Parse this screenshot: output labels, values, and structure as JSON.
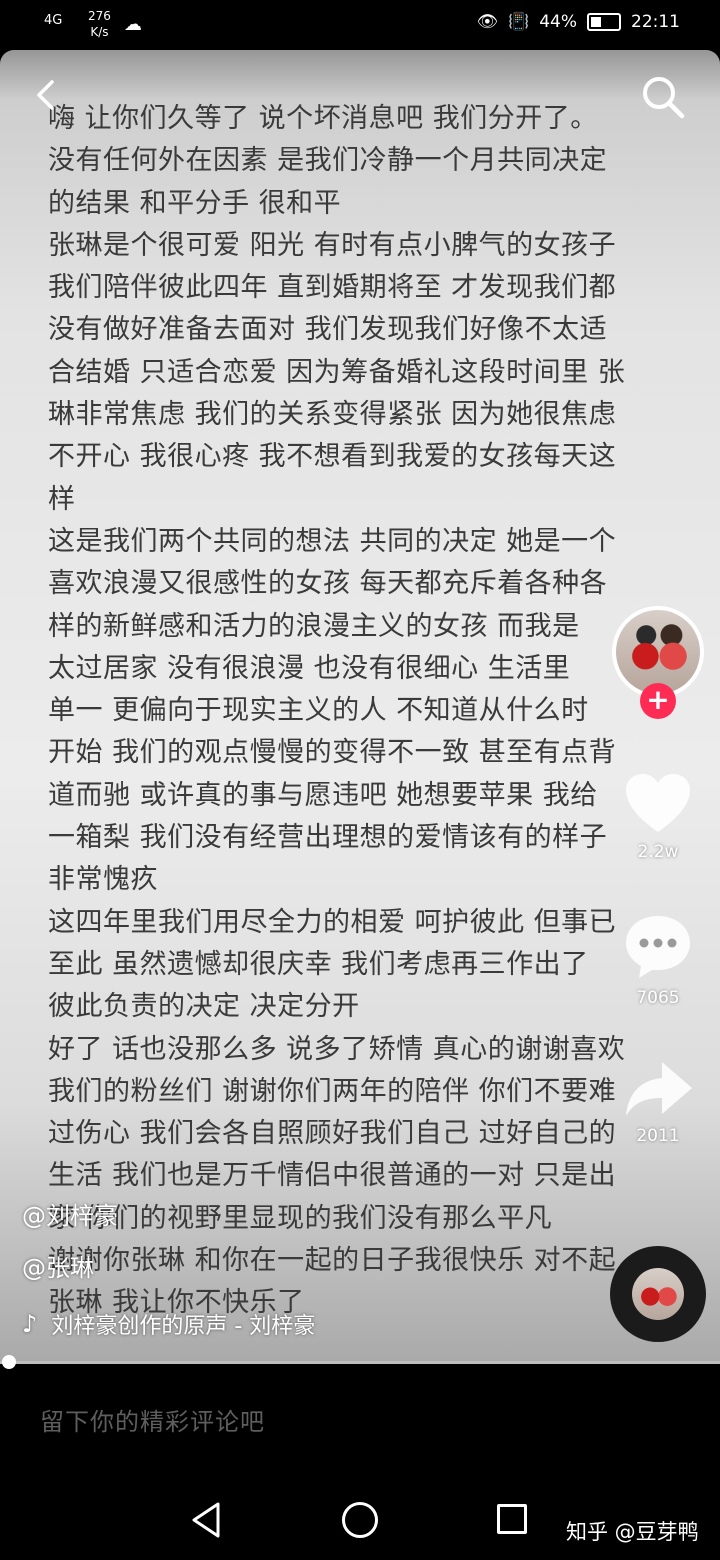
{
  "status_bar": {
    "signal": "4G",
    "speed_value": "276",
    "speed_unit": "K/s",
    "battery": "44%",
    "time": "22:11"
  },
  "memo": {
    "lines": [
      "嗨 让你们久等了 说个坏消息吧 我们分开了。",
      "没有任何外在因素 是我们冷静一个月共同决定",
      "的结果 和平分手 很和平",
      "张琳是个很可爱 阳光 有时有点小脾气的女孩子",
      "我们陪伴彼此四年 直到婚期将至 才发现我们都",
      "没有做好准备去面对 我们发现我们好像不太适",
      "合结婚 只适合恋爱 因为筹备婚礼这段时间里 张",
      "琳非常焦虑 我们的关系变得紧张 因为她很焦虑",
      "不开心 我很心疼 我不想看到我爱的女孩每天这",
      "样",
      "这是我们两个共同的想法 共同的决定 她是一个",
      "喜欢浪漫又很感性的女孩 每天都充斥着各种各",
      "样的新鲜感和活力的浪漫主义的女孩 而我是",
      "太过居家 没有很浪漫 也没有很细心 生活里",
      "单一 更偏向于现实主义的人 不知道从什么时",
      "开始 我们的观点慢慢的变得不一致 甚至有点背",
      "道而驰 或许真的事与愿违吧 她想要苹果 我给",
      "一箱梨 我们没有经营出理想的爱情该有的样子",
      "非常愧疚",
      "这四年里我们用尽全力的相爱 呵护彼此 但事已",
      "至此 虽然遗憾却很庆幸 我们考虑再三作出了",
      "彼此负责的决定 决定分开",
      "好了 话也没那么多 说多了矫情 真心的谢谢喜欢",
      "我们的粉丝们 谢谢你们两年的陪伴 你们不要难",
      "过伤心 我们会各自照顾好我们自己 过好自己的",
      "生活 我们也是万千情侣中很普通的一对 只是出",
      "家 你们的视野里显现的我们没有那么平凡",
      "谢谢你张琳 和你在一起的日子我很快乐 对不起",
      "张琳 我让你不快乐了"
    ]
  },
  "sidebar": {
    "like_count": "2.2w",
    "comment_count": "7065",
    "share_count": "2011"
  },
  "overlay": {
    "author": "@刘梓豪",
    "mention": "@张琳",
    "music": "刘梓豪创作的原声 - 刘梓豪"
  },
  "comment_bar": {
    "placeholder": "留下你的精彩评论吧"
  },
  "watermark": "知乎 @豆芽鸭",
  "icons": {
    "back": "chevron-left-icon",
    "search": "search-icon",
    "like": "heart-icon",
    "comment": "comment-icon",
    "share": "share-icon",
    "music": "music-note-icon",
    "follow": "plus-icon"
  },
  "colors": {
    "follow_accent": "#fe2c55",
    "memo_text": "#3a3a3a"
  }
}
